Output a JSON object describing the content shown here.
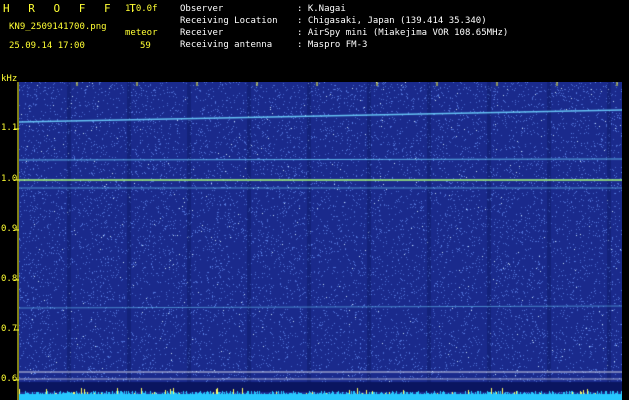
{
  "header": {
    "title": "H R O F F T",
    "version": "1.0.0f",
    "filename": "KN9_2509141700.png",
    "meteor_label": "meteor",
    "meteor_count": "59",
    "datetime": "25.09.14 17:00",
    "fields": [
      {
        "label": "Observer",
        "value": ": K.Nagai"
      },
      {
        "label": "Receiving Location",
        "value": ": Chigasaki, Japan (139.414 35.340)"
      },
      {
        "label": "Receiver",
        "value": ": AirSpy mini (Miakejima VOR 108.65MHz)"
      },
      {
        "label": "Receiving antenna",
        "value": ": Maspro FM-3"
      }
    ]
  },
  "plot": {
    "y_unit": "kHz",
    "y_ticks": [
      "1.1",
      "1.0",
      "0.9",
      "0.8",
      "0.7",
      "0.6"
    ],
    "x_ticks": [
      "1701",
      "1702",
      "1703",
      "1704",
      "1705",
      "1706",
      "1707",
      "1708",
      "1709",
      "1710"
    ],
    "colors": {
      "background": "#1a2a8c",
      "noise": "#4a6ad0",
      "bright_line": "#a8ff7a",
      "faint_line": "#6fd4ff",
      "bottom_band": "#27c8ff",
      "tick": "#ffff33"
    }
  }
}
